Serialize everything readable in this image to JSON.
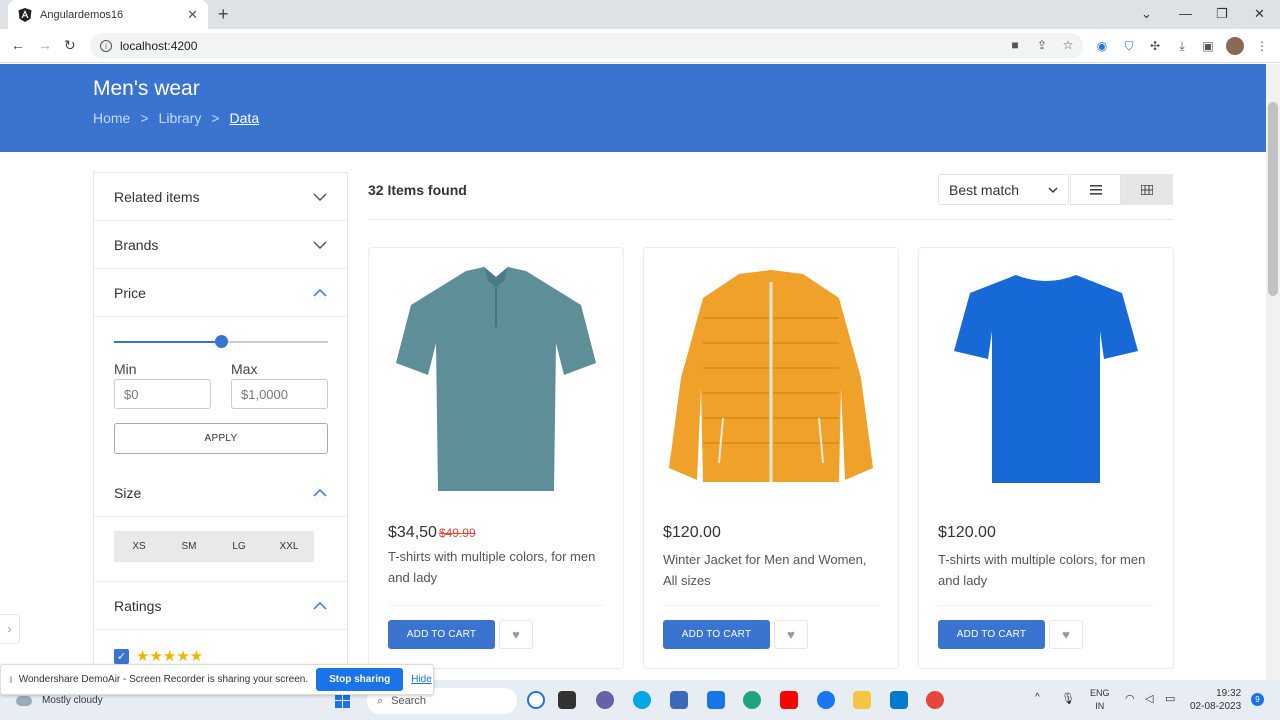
{
  "browser": {
    "tab_title": "Angulardemos16",
    "url": "localhost:4200",
    "new_tab_label": "+",
    "close_tab_label": "✕"
  },
  "header": {
    "title": "Men's wear",
    "breadcrumbs": [
      "Home",
      ">",
      "Library",
      ">",
      "Data"
    ]
  },
  "sidebar": {
    "sections": {
      "related": "Related items",
      "brands": "Brands",
      "price": "Price",
      "size": "Size",
      "ratings": "Ratings"
    },
    "price": {
      "min_label": "Min",
      "max_label": "Max",
      "min_placeholder": "$0",
      "max_placeholder": "$1,0000",
      "apply": "APPLY",
      "slider_value": 0.5
    },
    "sizes": [
      "XS",
      "SM",
      "LG",
      "XXL"
    ],
    "rating_stars": "★★★★★",
    "rating_checked": true
  },
  "results": {
    "count_text": "32 Items found",
    "sort_value": "Best match"
  },
  "products": [
    {
      "price": "$34,50",
      "old_price": "$49.99",
      "desc": "T-shirts with multiple colors, for men and lady",
      "cart": "ADD TO CART",
      "color": "#5e8f99"
    },
    {
      "price": "$120.00",
      "old_price": "",
      "desc": "Winter Jacket for Men and Women, All sizes",
      "cart": "ADD TO CART",
      "color": "#f0a12a"
    },
    {
      "price": "$120.00",
      "old_price": "",
      "desc": "T-shirts with multiple colors, for men and lady",
      "cart": "ADD TO CART",
      "color": "#1769d8"
    }
  ],
  "sharing_bar": {
    "message": "Wondershare DemoAir - Screen Recorder is sharing your screen.",
    "stop": "Stop sharing",
    "hide": "Hide"
  },
  "taskbar": {
    "weather": "Mostly cloudy",
    "search": "Search",
    "lang_top": "ENG",
    "lang_bottom": "IN",
    "time": "19:32",
    "date": "02-08-2023",
    "notifications": "9"
  },
  "colors": {
    "accent": "#3b73d0",
    "star": "#f0b400"
  }
}
